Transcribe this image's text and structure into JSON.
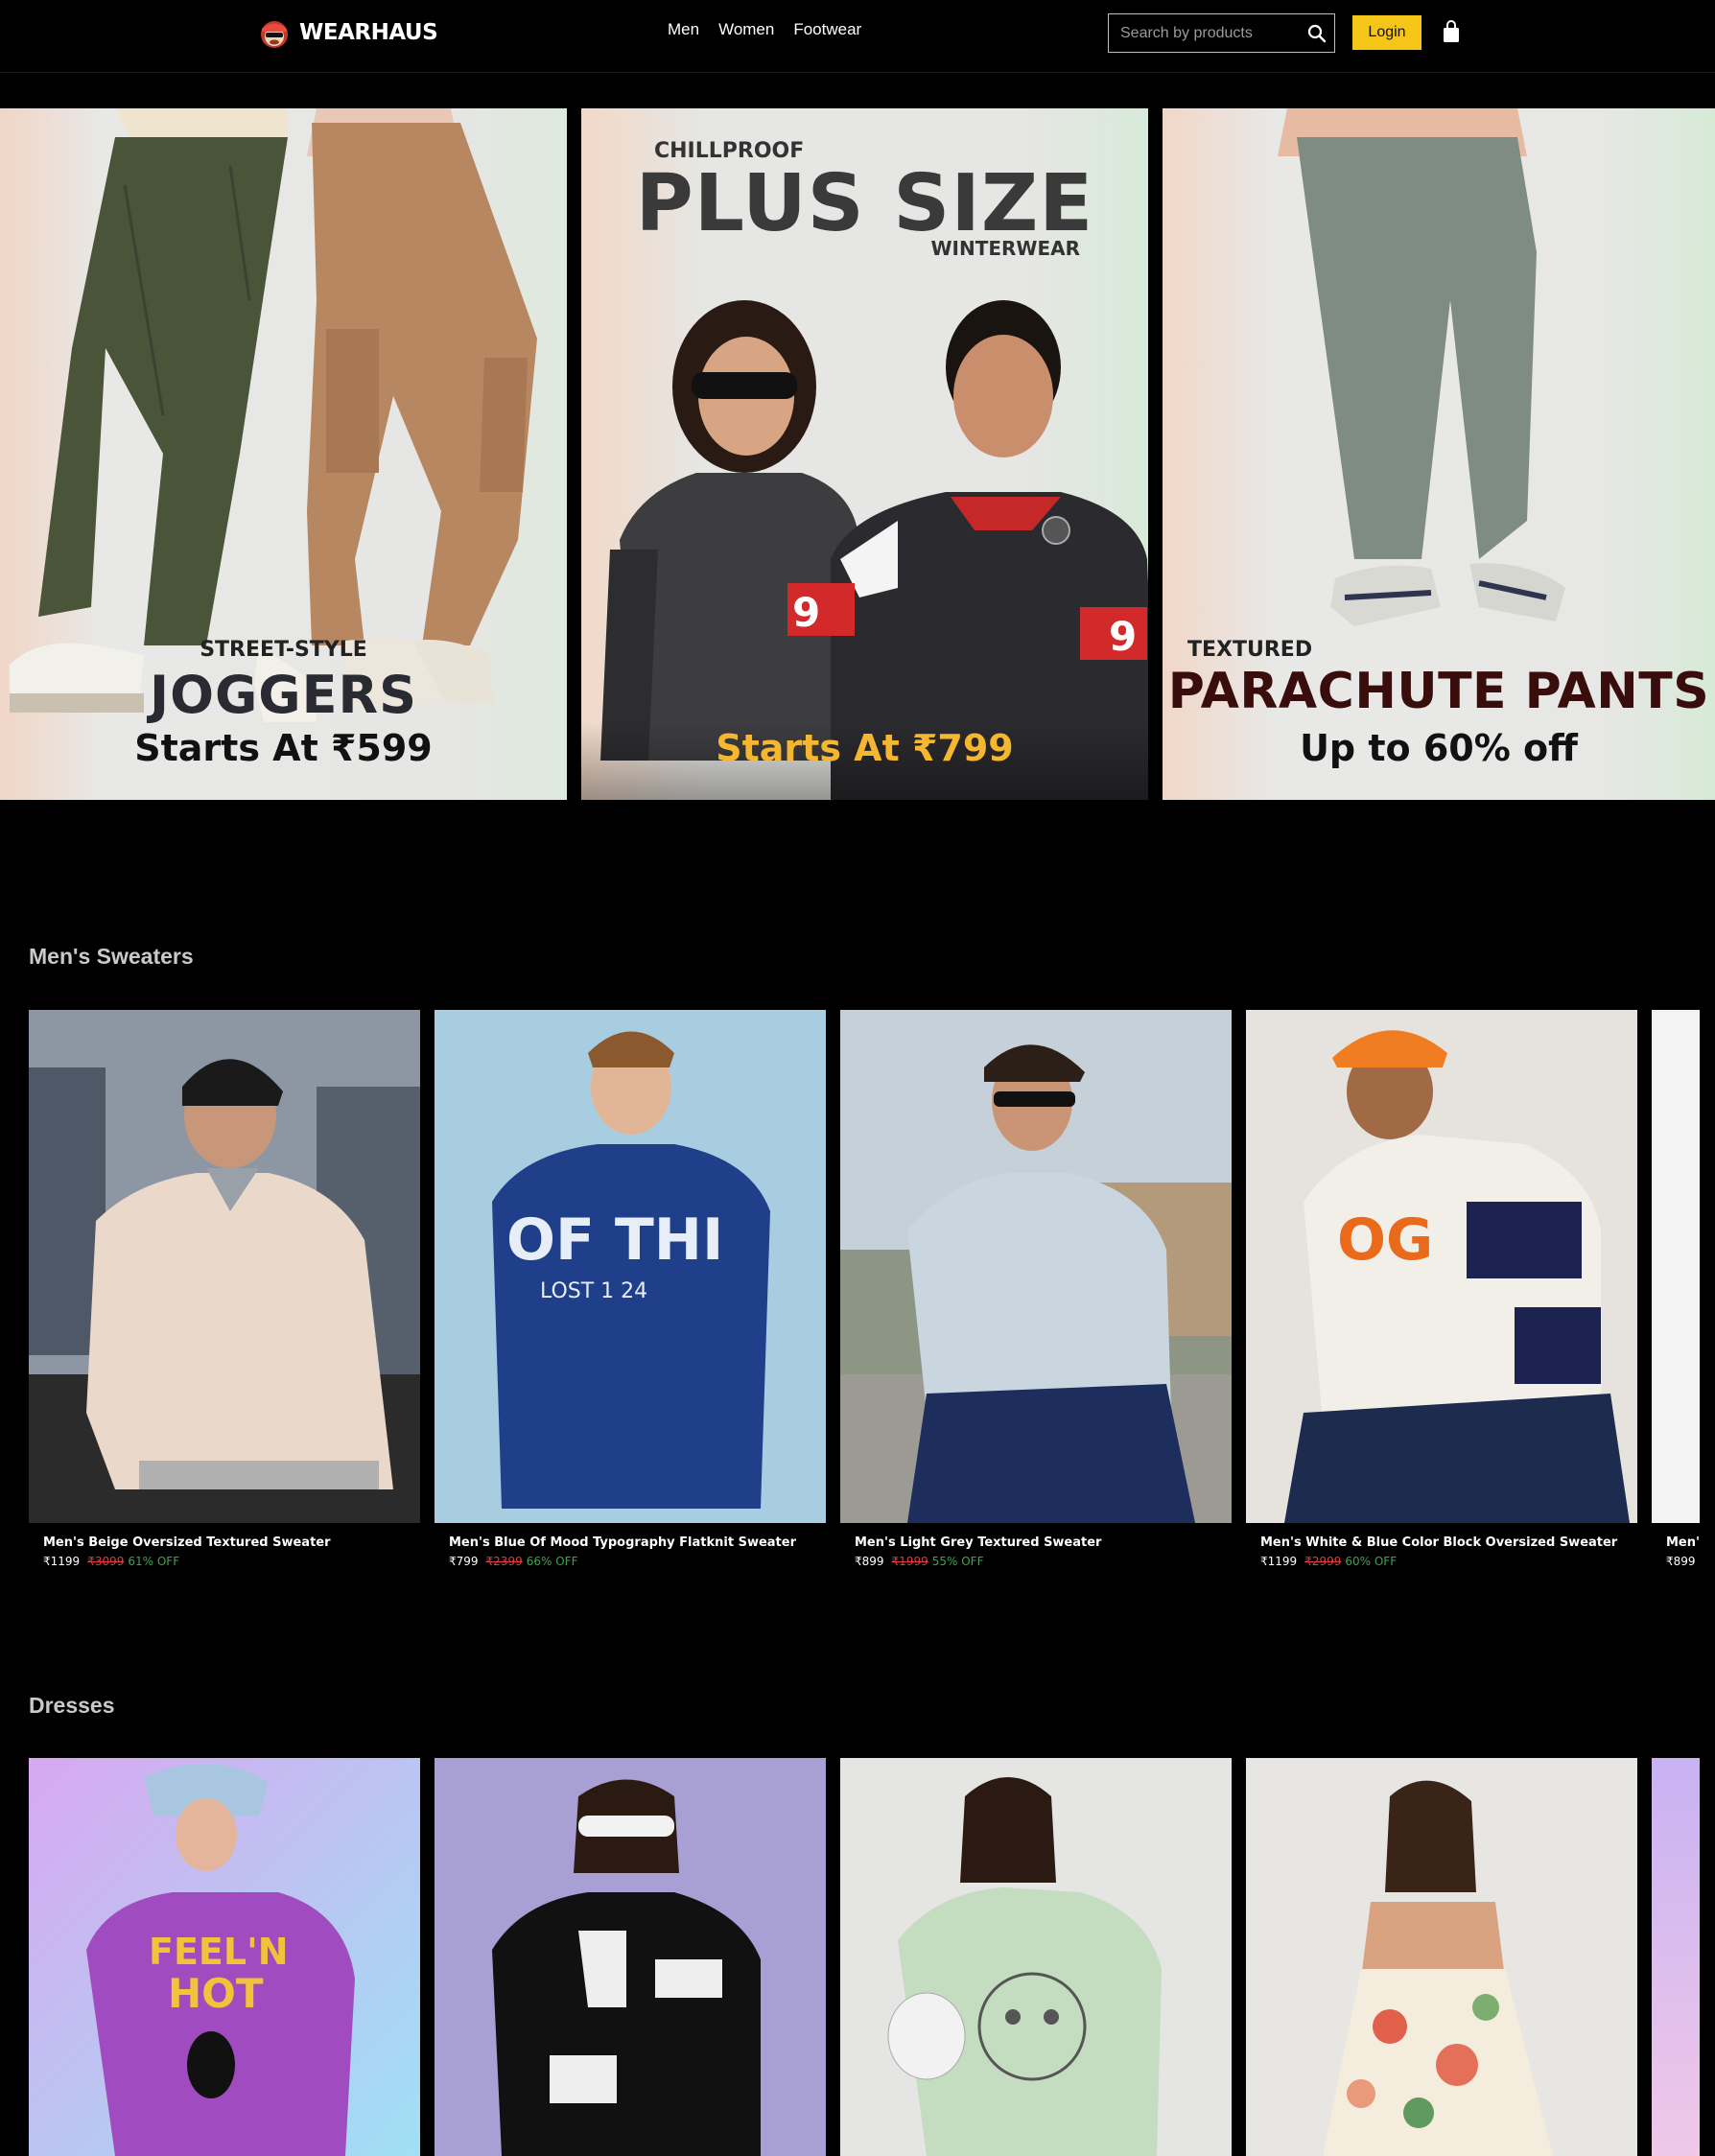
{
  "header": {
    "brand": "WEARHAUS",
    "nav": [
      "Men",
      "Women",
      "Footwear"
    ],
    "search_placeholder": "Search by products",
    "login_label": "Login"
  },
  "banners": [
    {
      "kicker": "STREET-STYLE",
      "headline": "JOGGERS",
      "offer": "Starts At ₹599"
    },
    {
      "kicker": "CHILLPROOF",
      "headline": "PLUS SIZE",
      "subhead": "WINTERWEAR",
      "offer": "Starts At ₹799"
    },
    {
      "kicker": "TEXTURED",
      "headline": "PARACHUTE PANTS",
      "offer": "Up to 60% off"
    }
  ],
  "sections": [
    {
      "title": "Men's Sweaters",
      "products": [
        {
          "name": "Men's Beige Oversized Textured Sweater",
          "price": "₹1199",
          "mrp": "₹3099",
          "off": "61% OFF"
        },
        {
          "name": "Men's Blue Of Mood Typography Flatknit Sweater",
          "price": "₹799",
          "mrp": "₹2399",
          "off": "66% OFF"
        },
        {
          "name": "Men's Light Grey Textured Sweater",
          "price": "₹899",
          "mrp": "₹1999",
          "off": "55% OFF"
        },
        {
          "name": "Men's White & Blue Color Block Oversized Sweater",
          "price": "₹1199",
          "mrp": "₹2999",
          "off": "60% OFF"
        },
        {
          "name": "Men's",
          "price": "₹899"
        }
      ]
    },
    {
      "title": "Dresses",
      "products": []
    }
  ],
  "colors": {
    "accent": "#f5c518",
    "discount": "#3fa34d",
    "mrp_strike": "#e23c3c",
    "background": "#000000"
  }
}
